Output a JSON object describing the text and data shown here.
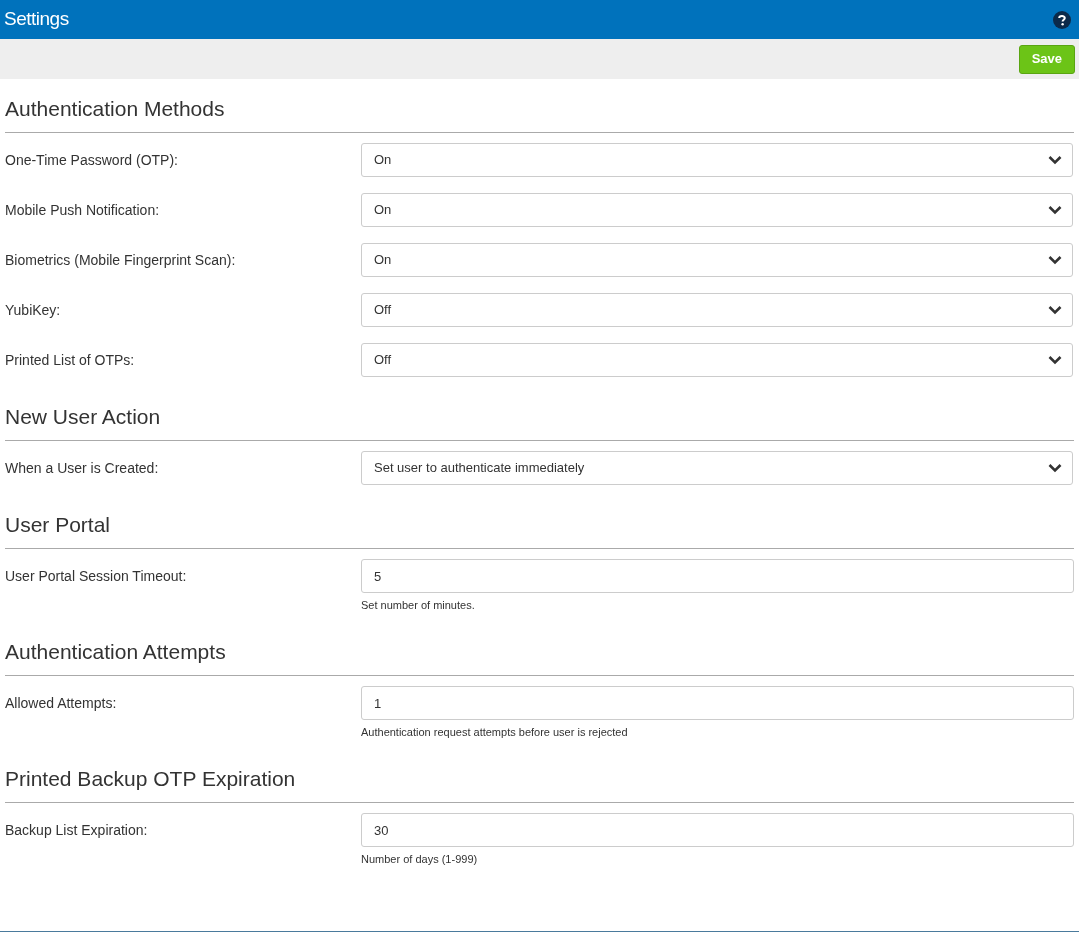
{
  "header": {
    "title": "Settings"
  },
  "toolbar": {
    "save_button": "Save"
  },
  "sections": [
    {
      "title": "Authentication Methods",
      "rows": [
        {
          "kind": "select",
          "label": "One-Time Password (OTP):",
          "value": "On"
        },
        {
          "kind": "select",
          "label": "Mobile Push Notification:",
          "value": "On"
        },
        {
          "kind": "select",
          "label": "Biometrics (Mobile Fingerprint Scan):",
          "value": "On"
        },
        {
          "kind": "select",
          "label": "YubiKey:",
          "value": "Off"
        },
        {
          "kind": "select",
          "label": "Printed List of OTPs:",
          "value": "Off"
        }
      ]
    },
    {
      "title": "New User Action",
      "rows": [
        {
          "kind": "select",
          "label": "When a User is Created:",
          "value": "Set user to authenticate immediately"
        }
      ]
    },
    {
      "title": "User Portal",
      "rows": [
        {
          "kind": "input",
          "label": "User Portal Session Timeout:",
          "value": "5",
          "hint": "Set number of minutes."
        }
      ]
    },
    {
      "title": "Authentication Attempts",
      "rows": [
        {
          "kind": "input",
          "label": "Allowed Attempts:",
          "value": "1",
          "hint": "Authentication request attempts before user is rejected"
        }
      ]
    },
    {
      "title": "Printed Backup OTP Expiration",
      "rows": [
        {
          "kind": "input",
          "label": "Backup List Expiration:",
          "value": "30",
          "hint": "Number of days (1-999)"
        }
      ]
    }
  ]
}
